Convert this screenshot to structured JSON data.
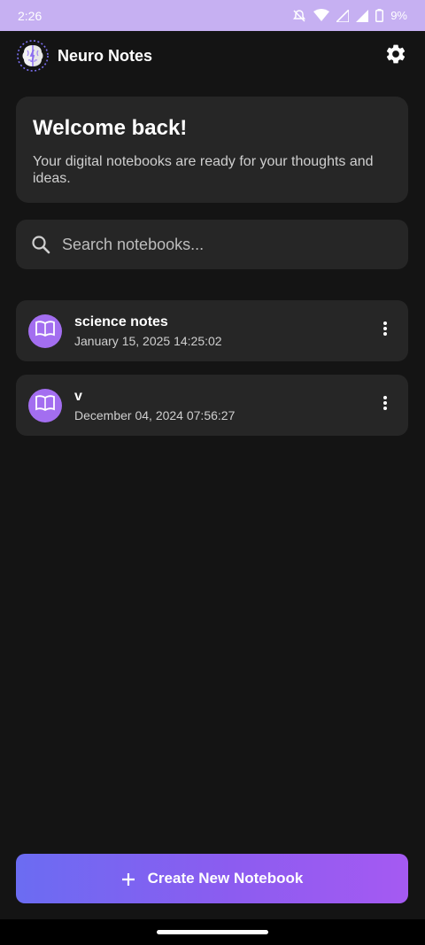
{
  "status_bar": {
    "time": "2:26",
    "battery": "9%",
    "icons": [
      "bell-off-icon",
      "wifi-icon",
      "signal-icon",
      "signal-icon",
      "battery-icon"
    ]
  },
  "header": {
    "title": "Neuro Notes",
    "logo_icon": "brain-icon",
    "settings_icon": "gear-icon"
  },
  "welcome": {
    "title": "Welcome back!",
    "text": "Your digital notebooks are ready for your thoughts and ideas."
  },
  "search": {
    "placeholder": "Search notebooks...",
    "value": ""
  },
  "notebooks": [
    {
      "title": "science notes",
      "date": "January 15, 2025 14:25:02",
      "icon": "book-icon"
    },
    {
      "title": "v",
      "date": "December 04, 2024 07:56:27",
      "icon": "book-icon"
    }
  ],
  "create_button": {
    "label": "Create New Notebook",
    "icon": "plus-icon"
  },
  "colors": {
    "background": "#141414",
    "card": "#262626",
    "accent": "#a36ef0",
    "status_bar": "#c6b0f2",
    "gradient_start": "#6b6cf2",
    "gradient_end": "#a55af2"
  }
}
